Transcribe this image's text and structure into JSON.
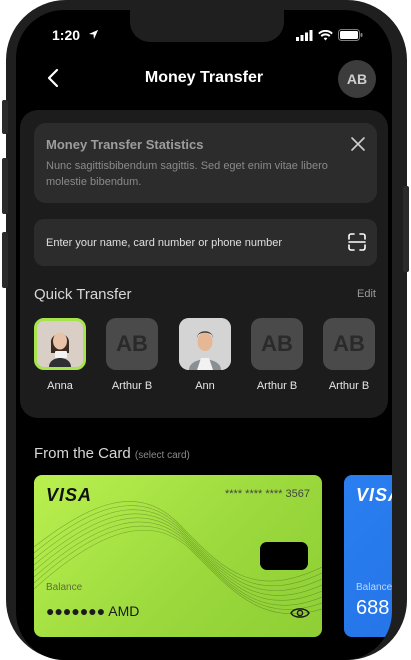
{
  "status": {
    "time": "1:20"
  },
  "header": {
    "title": "Money Transfer",
    "avatar_initials": "AB"
  },
  "notice": {
    "title": "Money Transfer Statistics",
    "text": "Nunc sagittisbibendum sagittis. Sed eget enim vitae libero molestie bibendum."
  },
  "search": {
    "placeholder": "Enter your name, card number or phone number"
  },
  "quick_transfer": {
    "title": "Quick Transfer",
    "edit_label": "Edit",
    "contacts": [
      {
        "name": "Anna",
        "initials": "",
        "selected": true
      },
      {
        "name": "Arthur B",
        "initials": "AB",
        "selected": false
      },
      {
        "name": "Ann",
        "initials": "",
        "selected": false
      },
      {
        "name": "Arthur B",
        "initials": "AB",
        "selected": false
      },
      {
        "name": "Arthur B",
        "initials": "AB",
        "selected": false
      }
    ]
  },
  "from_card": {
    "title": "From the Card",
    "subtitle": "(select card)",
    "cards": [
      {
        "brand": "VISA",
        "number": "**** **** **** 3567",
        "balance_label": "Balance",
        "balance": "●●●●●●● AMD",
        "color": "#a6e44b"
      },
      {
        "brand": "VISA",
        "number": "",
        "balance_label": "Balance",
        "balance": "688",
        "color": "#2a7ff0"
      }
    ]
  },
  "colors": {
    "accent": "#a6e44b",
    "background": "#000000",
    "panel": "#1c1c1c"
  }
}
